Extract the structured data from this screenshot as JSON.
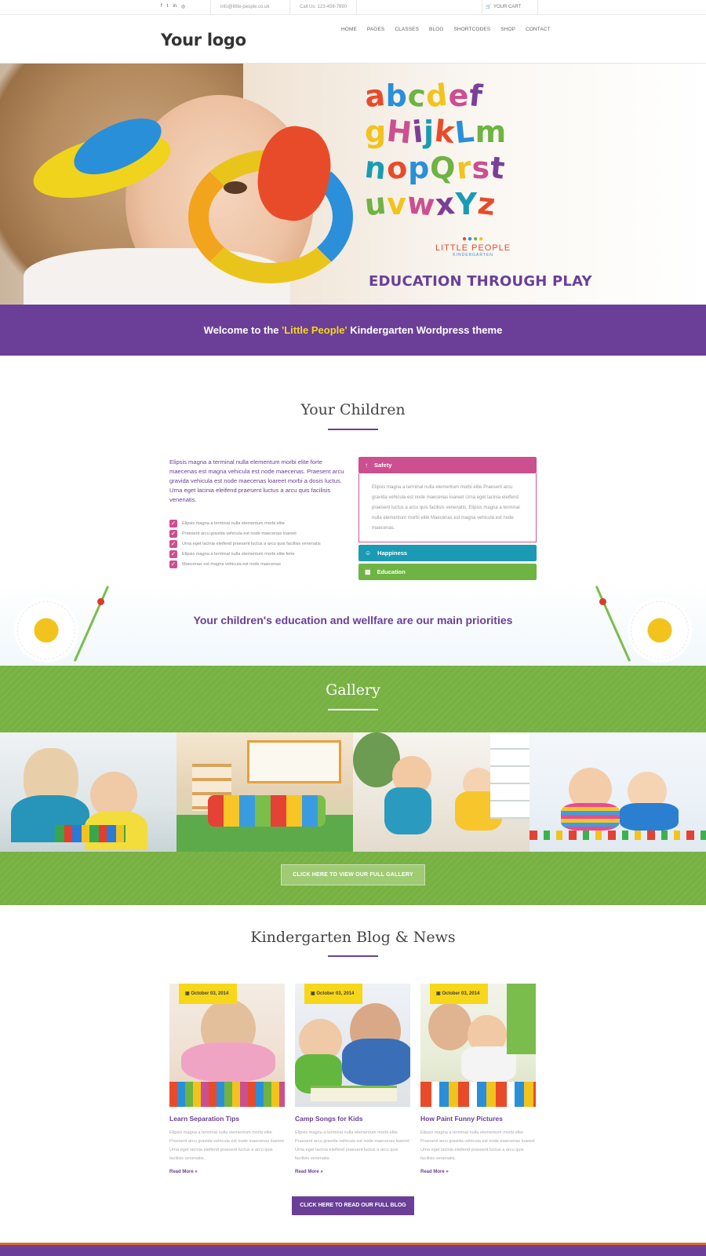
{
  "topbar": {
    "social_icons": [
      "facebook-icon",
      "twitter-icon",
      "linkedin-icon",
      "rss-icon"
    ],
    "social_glyphs": [
      "f",
      "t",
      "in",
      "◎"
    ],
    "email": "info@little-people.co.uk",
    "phone": "Call Us: 123-456-7890",
    "cart": "YOUR CART"
  },
  "header": {
    "logo": "Your logo",
    "nav": [
      "HOME",
      "PAGES",
      "CLASSES",
      "BLOG",
      "SHORTCODES",
      "SHOP",
      "CONTACT"
    ]
  },
  "hero": {
    "letter_rows": [
      "abcdef",
      "gHijkLm",
      "nopQrst",
      "uvwxYz"
    ],
    "brand_name": "LITTLE PEOPLE",
    "brand_sub": "KINDERGARTEN",
    "tagline": "EDUCATION THROUGH PLAY"
  },
  "welcome": {
    "before": "Welcome to the ",
    "highlight": "'Little People'",
    "after": " Kindergarten Wordpress theme"
  },
  "children": {
    "title": "Your Children",
    "intro": "Elipsis magna a terminal nulla elementum morbi elite forte maecenas est magna vehicula est node maecenas. Praesent arcu gravida vehicula est node maecenas loareet morbi a dosis luctus. Urna eget lacinia eleifend praesent luctus a arcu quis facilisis venenatis.",
    "checklist": [
      "Elipsis magna a terminal nulla elementum morbi elite",
      "Praesent arcu gravida vehicula est node maecenas loareet",
      "Urna eget lacinia eleifend praesent luctus a arcu quis facilisis venenatis",
      "Elipsis magna a terminal nulla elementum morbi elite forte",
      "Maecenas est magna vehicula est node maecenas"
    ],
    "accordion": [
      {
        "label": "Safety",
        "body": "Elipsis magna a terminal nulla elementum morbi elite Praesent arcu gravida vehicula est node maecenas loareet Urna eget lacinia eleifend praesent luctus a arcu quis facilisis venenatis. Elipsis magna a terminal nulla elementum morbi elite Maecenas est magna vehicula est node maecenas."
      },
      {
        "label": "Happiness"
      },
      {
        "label": "Education"
      }
    ]
  },
  "priorities": "Your children's education and wellfare are our main priorities",
  "gallery": {
    "title": "Gallery",
    "button": "CLICK HERE TO VIEW OUR FULL GALLERY"
  },
  "blog": {
    "title": "Kindergarten Blog & News",
    "posts": [
      {
        "date": "October 03, 2014",
        "title": "Learn Separation Tips",
        "excerpt": "Elipsis magna a terminal nulla elementum morbi elite Praesent arcu gravida vehicula est node maecenas loareet Urna eget lacinia eleifend praesent luctus a arcu quis facilisis venenatis.",
        "more": "Read More »"
      },
      {
        "date": "October 03, 2014",
        "title": "Camp Songs for Kids",
        "excerpt": "Elipsis magna a terminal nulla elementum morbi elite Praesent arcu gravida vehicula est node maecenas loareet Urna eget lacinia eleifend praesent luctus a arcu quis facilisis venenatis.",
        "more": "Read More »"
      },
      {
        "date": "October 03, 2014",
        "title": "How Paint Funny Pictures",
        "excerpt": "Elipsis magna a terminal nulla elementum morbi elite Praesent arcu gravida vehicula est node maecenas loareet Urna eget lacinia eleifend praesent luctus a arcu quis facilisis venenatis.",
        "more": "Read More »"
      }
    ],
    "button": "CLICK HERE TO READ OUR FULL BLOG"
  },
  "colors": {
    "purple": "#6b3f97",
    "yellow": "#f7d71a",
    "pink": "#cc4f90",
    "teal": "#1b9bb3",
    "green": "#76b142",
    "orange": "#e4672a"
  }
}
